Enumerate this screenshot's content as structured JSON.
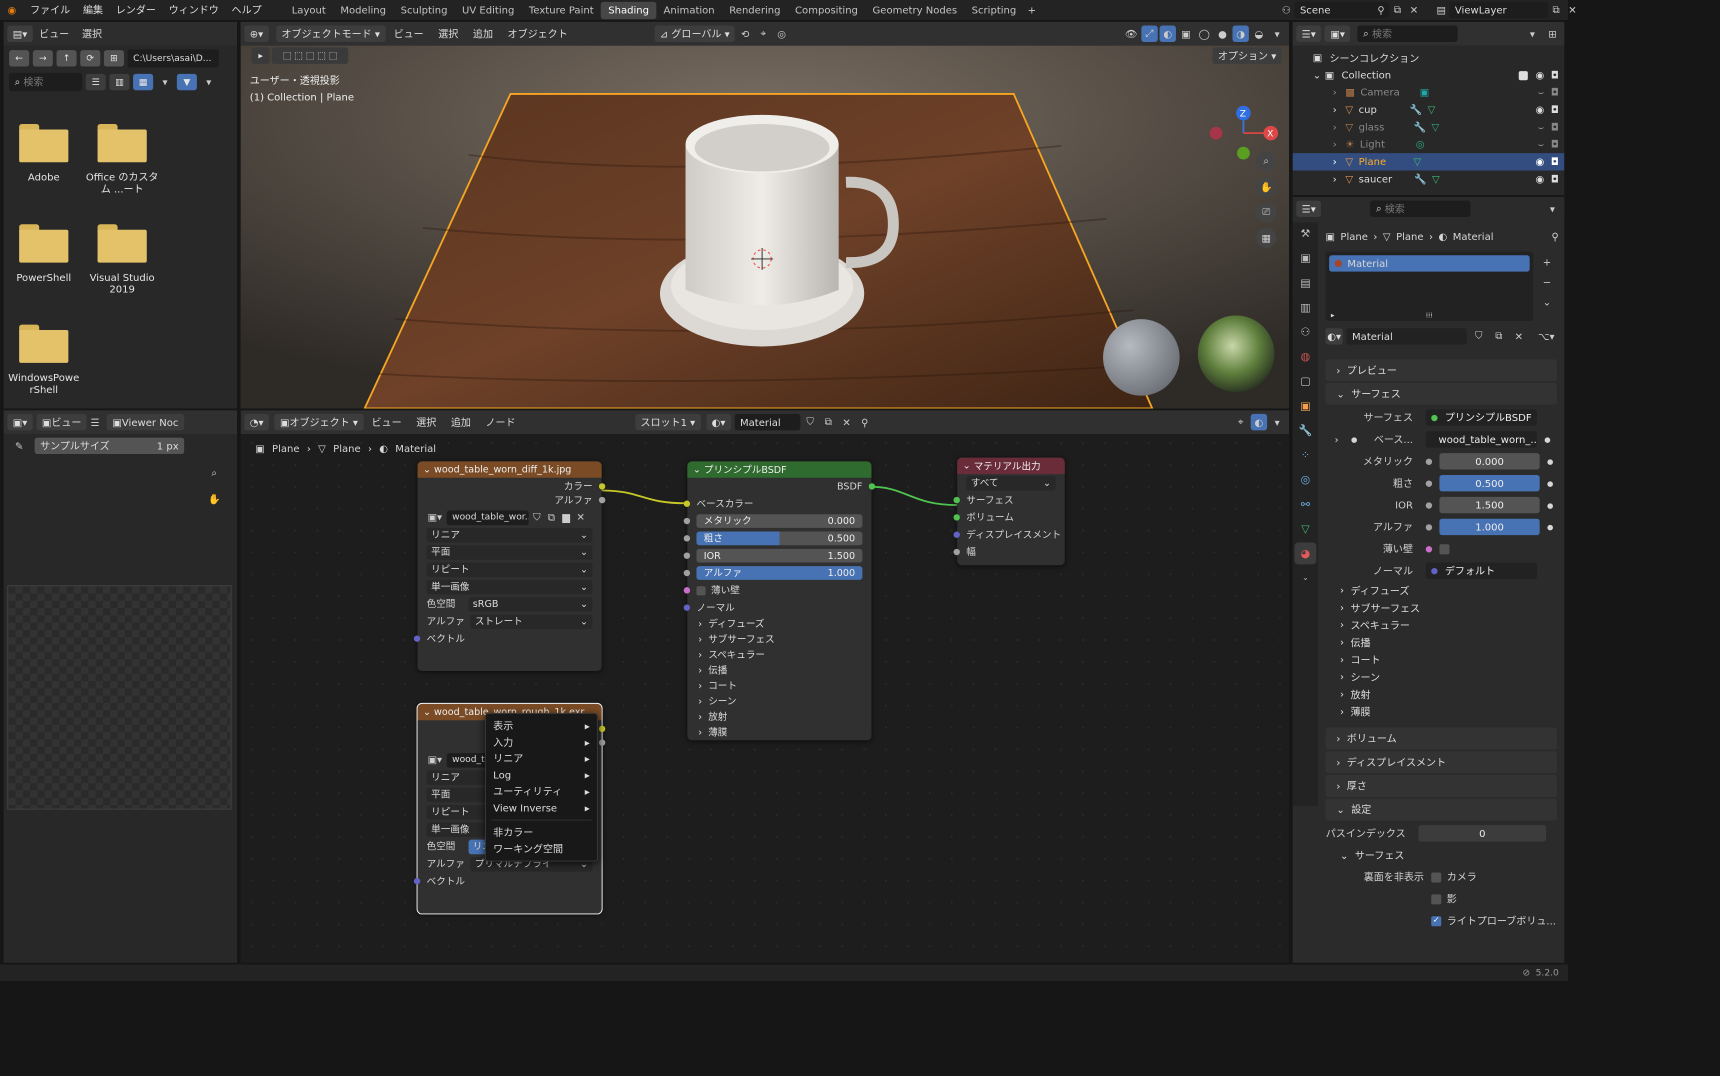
{
  "topbar": {
    "menus": [
      "ファイル",
      "編集",
      "レンダー",
      "ウィンドウ",
      "ヘルプ"
    ],
    "workspaces": [
      "Layout",
      "Modeling",
      "Sculpting",
      "UV Editing",
      "Texture Paint",
      "Shading",
      "Animation",
      "Rendering",
      "Compositing",
      "Geometry Nodes",
      "Scripting"
    ],
    "active_workspace": "Shading",
    "scene": "Scene",
    "view_layer": "ViewLayer"
  },
  "file_browser": {
    "menus": [
      "ビュー",
      "選択"
    ],
    "path": "C:\\Users\\asai\\D...",
    "search_placeholder": "検索",
    "folders": [
      "Adobe",
      "Office のカスタム ...ート",
      "PowerShell",
      "Visual Studio 2019",
      "WindowsPowerShell"
    ]
  },
  "viewport": {
    "mode": "オブジェクトモード",
    "menus": [
      "ビュー",
      "選択",
      "追加",
      "オブジェクト"
    ],
    "transform": "グローバル",
    "options": "オプション",
    "info_line1": "ユーザー・透視投影",
    "info_line2": "(1) Collection | Plane",
    "axis_x": "X",
    "axis_z": "Z"
  },
  "image_editor": {
    "menu_view": "ビュー",
    "viewer": "Viewer Noc",
    "sample_label": "サンプルサイズ",
    "sample_value": "1 px"
  },
  "node_editor": {
    "mode": "オブジェクト",
    "menus": [
      "ビュー",
      "選択",
      "追加",
      "ノード"
    ],
    "slot": "スロット1",
    "material": "Material",
    "breadcrumb": [
      "Plane",
      "Plane",
      "Material"
    ],
    "tex1": {
      "title": "wood_table_worn_diff_1k.jpg",
      "out_color": "カラー",
      "out_alpha": "アルファ",
      "image": "wood_table_wor...",
      "interp": "リニア",
      "proj": "平面",
      "ext": "リピート",
      "source": "単一画像",
      "cs_label": "色空間",
      "cs_value": "sRGB",
      "alpha_label": "アルファ",
      "alpha_value": "ストレート",
      "vector": "ベクトル"
    },
    "tex2": {
      "title": "wood_table_worn_rough_1k.exr",
      "image": "wood_t",
      "interp": "リニア",
      "proj": "平面",
      "ext": "リピート",
      "source": "単一画像",
      "cs_label": "色空間",
      "cs_value": "リニア Rec.709",
      "alpha_label": "アルファ",
      "alpha_value": "プリマルチプライ",
      "vector": "ベクトル"
    },
    "bsdf": {
      "title": "プリンシプルBSDF",
      "out": "BSDF",
      "base_color": "ベースカラー",
      "metallic_label": "メタリック",
      "metallic": "0.000",
      "rough_label": "粗さ",
      "rough": "0.500",
      "ior_label": "IOR",
      "ior": "1.500",
      "alpha_label": "アルファ",
      "alpha": "1.000",
      "thin": "薄い壁",
      "normal": "ノーマル",
      "panels": [
        "ディフューズ",
        "サブサーフェス",
        "スペキュラー",
        "伝播",
        "コート",
        "シーン",
        "放射",
        "薄膜"
      ]
    },
    "output": {
      "title": "マテリアル出力",
      "target": "すべて",
      "inputs": [
        "サーフェス",
        "ボリューム",
        "ディスプレイスメント",
        "幅"
      ]
    },
    "context_menu": [
      "表示",
      "入力",
      "リニア",
      "Log",
      "ユーティリティ",
      "View Inverse",
      "非カラー",
      "ワーキング空間"
    ]
  },
  "outliner": {
    "search_placeholder": "検索",
    "root": "シーンコレクション",
    "collection": "Collection",
    "items": [
      "Camera",
      "cup",
      "glass",
      "Light",
      "Plane",
      "saucer"
    ],
    "selected": "Plane"
  },
  "properties": {
    "search_placeholder": "検索",
    "breadcrumb": [
      "Plane",
      "Plane",
      "Material"
    ],
    "slot_name": "Material",
    "material_name": "Material",
    "sections": {
      "preview": "プレビュー",
      "surface": "サーフェス",
      "volume": "ボリューム",
      "displacement": "ディスプレイスメント",
      "thickness": "厚さ",
      "settings": "設定"
    },
    "surface_label": "サーフェス",
    "surface_value": "プリンシプルBSDF",
    "base_label": "ベース...",
    "base_value": "wood_table_worn_...",
    "metallic_label": "メタリック",
    "metallic": "0.000",
    "rough_label": "粗さ",
    "rough": "0.500",
    "ior_label": "IOR",
    "ior": "1.500",
    "alpha_label": "アルファ",
    "alpha": "1.000",
    "thin_label": "薄い壁",
    "normal_label": "ノーマル",
    "normal_value": "デフォルト",
    "subpanels": [
      "ディフューズ",
      "サブサーフェス",
      "スペキュラー",
      "伝播",
      "コート",
      "シーン",
      "放射",
      "薄膜"
    ],
    "pass_label": "パスインデックス",
    "pass_value": "0",
    "settings_surface": "サーフェス",
    "backface_label": "裏面を非表示",
    "backface_camera": "カメラ",
    "backface_shadow": "影",
    "lightprobe": "ライトプローブボリュ..."
  },
  "status": {
    "version": "5.2.0"
  },
  "colors": {
    "accent": "#4772b3",
    "active_tab": "#474747",
    "tex_header": "#7a4b24",
    "bsdf_header": "#2f6a2e",
    "output_header": "#6a2c39"
  }
}
